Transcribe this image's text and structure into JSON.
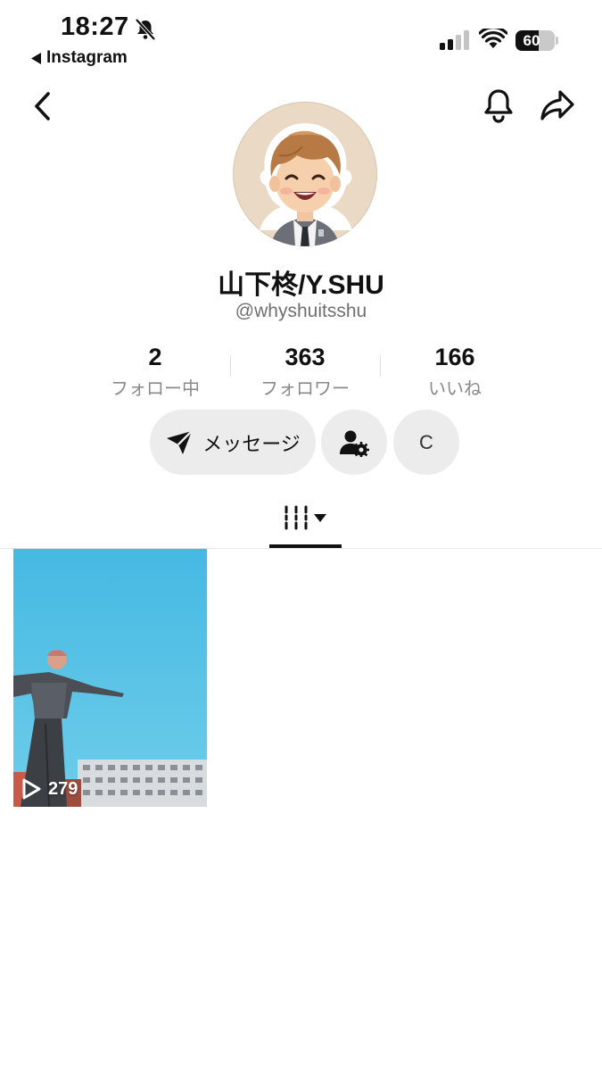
{
  "status_bar": {
    "time": "18:27",
    "back_app": "Instagram",
    "battery": "60",
    "battery_level": 0.6
  },
  "icons": {
    "bell_off": "bell-slash-icon",
    "back_triangle": "back-triangle-icon",
    "signal": "cellular-signal-icon",
    "wifi": "wifi-icon",
    "nav_back": "chevron-left-icon",
    "nav_bell": "bell-icon",
    "nav_share": "share-arrow-icon",
    "send": "send-icon",
    "friend_settings": "user-gear-icon",
    "tab_grid": "video-grid-icon",
    "tab_caret": "caret-down-icon",
    "play": "play-icon"
  },
  "profile": {
    "display_name": "山下柊/Y.SHU",
    "handle": "@whyshuitsshu"
  },
  "stats": [
    {
      "value": "2",
      "label": "フォロー中"
    },
    {
      "value": "363",
      "label": "フォロワー"
    },
    {
      "value": "166",
      "label": "いいね"
    }
  ],
  "actions": {
    "message_label": "メッセージ",
    "more_label": "C"
  },
  "videos": [
    {
      "views": "279"
    }
  ],
  "colors": {
    "button_bg": "#ececec",
    "sky": "#5ec4e6",
    "avatar_bg": "#ead9c4"
  }
}
